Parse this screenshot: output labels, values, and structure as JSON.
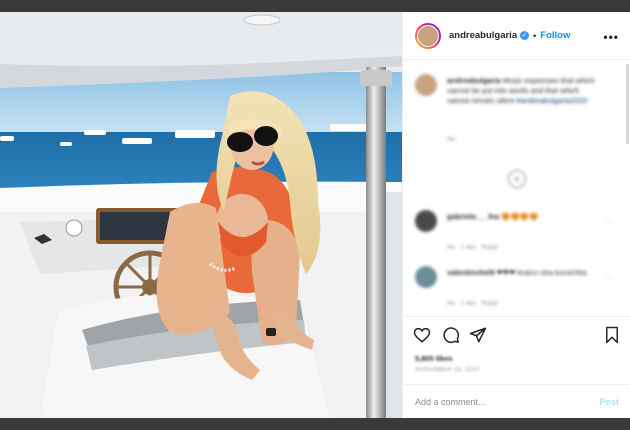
{
  "post": {
    "username": "andreabulgaria",
    "verified": true,
    "follow_label": "Follow",
    "more_icon": "more-options-icon",
    "caption": {
      "username": "andreabulgaria",
      "text": "Music expresses that which cannot be put into words and that which cannot remain silent",
      "hashtag": "#andreabulgaria2020",
      "time": "9w"
    },
    "comments": [
      {
        "username": "gabriela___fea",
        "text": "😍😍😍😍",
        "time": "9w",
        "likes": "1 like",
        "reply": "Reply",
        "avatar_color": "#4a4a4a"
      },
      {
        "username": "valentinchel9",
        "text": "❤❤❤ kratco utra kurvichka",
        "time": "9w",
        "likes": "1 like",
        "reply": "Reply",
        "avatar_color": "#6b8e9a"
      }
    ],
    "likes_text": "5,805 likes",
    "date_text": "NOVEMBER 15, 2020",
    "add_comment_placeholder": "Add a comment...",
    "post_button": "Post",
    "colors": {
      "accent": "#0095f6",
      "text": "#262626",
      "muted": "#8e8e8e",
      "post_disabled": "#b2dffc"
    }
  }
}
